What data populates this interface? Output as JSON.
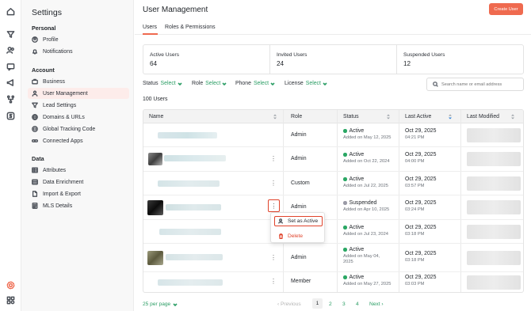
{
  "rail": {
    "icons": [
      "home-icon",
      "funnel-icon",
      "contacts-icon",
      "chat-icon",
      "megaphone-icon",
      "workflow-icon",
      "dollar-icon",
      "settings-gear-icon",
      "apps-icon"
    ]
  },
  "settings": {
    "title": "Settings",
    "sections": [
      {
        "label": "Personal",
        "items": [
          {
            "label": "Profile",
            "icon": "user-circle-icon"
          },
          {
            "label": "Notifications",
            "icon": "bell-icon"
          }
        ]
      },
      {
        "label": "Account",
        "items": [
          {
            "label": "Business",
            "icon": "briefcase-icon"
          },
          {
            "label": "User Management",
            "icon": "user-icon",
            "active": true
          },
          {
            "label": "Lead Settings",
            "icon": "funnel-icon"
          },
          {
            "label": "Domains & URLs",
            "icon": "globe-icon"
          },
          {
            "label": "Global Tracking Code",
            "icon": "code-icon"
          },
          {
            "label": "Connected Apps",
            "icon": "link-icon"
          }
        ]
      },
      {
        "label": "Data",
        "items": [
          {
            "label": "Attributes",
            "icon": "table-icon"
          },
          {
            "label": "Data Enrichment",
            "icon": "database-icon"
          },
          {
            "label": "Import & Export",
            "icon": "file-icon"
          },
          {
            "label": "MLS Details",
            "icon": "list-icon"
          }
        ]
      }
    ]
  },
  "header": {
    "title": "User Management",
    "create_button": "Create User"
  },
  "tabs": [
    {
      "label": "Users",
      "active": true
    },
    {
      "label": "Roles & Permissions"
    }
  ],
  "stats": [
    {
      "label": "Active Users",
      "value": "64"
    },
    {
      "label": "Invited Users",
      "value": "24"
    },
    {
      "label": "Suspended Users",
      "value": "12"
    }
  ],
  "filters": [
    {
      "label": "Status",
      "value": "Select"
    },
    {
      "label": "Role",
      "value": "Select"
    },
    {
      "label": "Phone",
      "value": "Select"
    },
    {
      "label": "License",
      "value": "Select"
    }
  ],
  "search": {
    "placeholder": "Search name or email address"
  },
  "user_count": "100 Users",
  "table": {
    "columns": [
      "Name",
      "Role",
      "Status",
      "Last Active",
      "Last Modified"
    ],
    "rows": [
      {
        "role": "Admin",
        "status": "Active",
        "added": "Added on May 12, 2025",
        "last_date": "Oct 29, 2025",
        "last_time": "04:21 PM"
      },
      {
        "role": "Admin",
        "status": "Active",
        "added": "Added on Oct 22, 2024",
        "last_date": "Oct 29, 2025",
        "last_time": "04:00 PM"
      },
      {
        "role": "Custom",
        "status": "Active",
        "added": "Added on Jul 22, 2025",
        "last_date": "Oct 29, 2025",
        "last_time": "03:57 PM"
      },
      {
        "role": "Admin",
        "status": "Suspended",
        "added": "Added on Apr 10, 2025",
        "last_date": "Oct 29, 2025",
        "last_time": "03:24 PM"
      },
      {
        "role": "",
        "status": "Active",
        "added": "Added on Jul 23, 2024",
        "last_date": "Oct 29, 2025",
        "last_time": "03:18 PM"
      },
      {
        "role": "Admin",
        "status": "Active",
        "added": "Added on May 04,",
        "added2": "2025",
        "last_date": "Oct 29, 2025",
        "last_time": "03:18 PM"
      },
      {
        "role": "Member",
        "status": "Active",
        "added": "Added on May 27, 2025",
        "last_date": "Oct 29, 2025",
        "last_time": "03:03 PM"
      }
    ]
  },
  "context_menu": {
    "set_active": "Set as Active",
    "delete": "Delete"
  },
  "pagination": {
    "per_page": "25 per page",
    "previous": "Previous",
    "pages": [
      "1",
      "2",
      "3",
      "4"
    ],
    "next": "Next"
  },
  "colors": {
    "accent": "#ef6a4f",
    "green": "#2a9d64",
    "danger": "#e0432b",
    "active_dot": "#2aa764",
    "suspended_dot": "#9a9aa6"
  }
}
